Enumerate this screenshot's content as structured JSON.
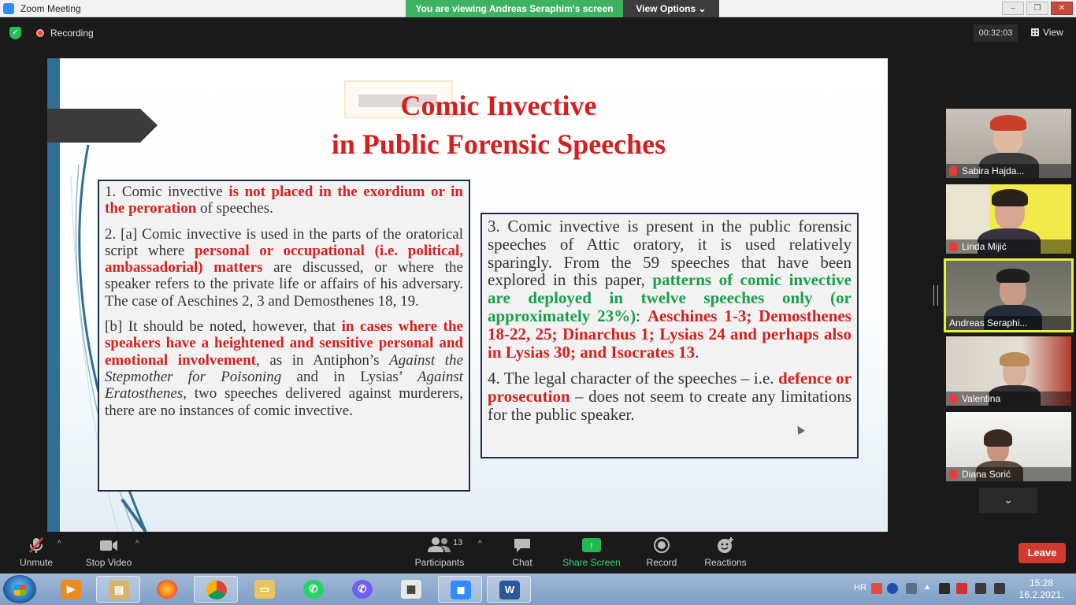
{
  "window": {
    "title": "Zoom Meeting"
  },
  "banner": {
    "viewing_text": "You are viewing Andreas Seraphim's screen",
    "view_options": "View Options"
  },
  "meeting": {
    "recording_label": "Recording",
    "timer": "00:32:03",
    "view_label": "View"
  },
  "slide": {
    "title_line1": "Comic Invective",
    "title_line2": "in Public Forensic Speeches",
    "box1": {
      "p1_a": "1. Comic invective ",
      "p1_b": "is not placed in the exordium or in the peroration",
      "p1_c": " of speeches.",
      "p2_a": "2. [a] Comic invective is used in the parts of the oratorical script where ",
      "p2_b": "personal or occupational (i.e. political, ambassadorial) matters",
      "p2_c": " are discussed, or where the speaker refers to the private life or affairs of his adversary. The case of Aeschines 2, 3 and Demosthenes 18, 19.",
      "p3_a": "[b] It should be noted, however, that ",
      "p3_b": "in cases where the speakers have a heightened and sensitive personal and emotional involvement",
      "p3_c": ", as in Antiphon’s ",
      "p3_d": "Against the Stepmother for Poisoning",
      "p3_e": " and in Lysias’ ",
      "p3_f": "Against Eratosthenes",
      "p3_g": ", two speeches delivered against murderers, there are no instances of comic invective."
    },
    "box2": {
      "p1_a": "3. Comic invective is present in the public forensic speeches of Attic oratory, it is used relatively sparingly. From the 59 speeches that have been explored in this paper, ",
      "p1_b": "patterns of comic invective are deployed in twelve speeches only (or approximately 23%)",
      "p1_c": ": ",
      "p1_d": "Aeschines 1-3; Demosthenes 18-22, 25; Dinarchus 1; Lysias 24 and perhaps also in Lysias 30; and Isocrates 13",
      "p1_e": ".",
      "p2_a": "4. The legal character of the speeches – i.e. ",
      "p2_b": "defence or prosecution",
      "p2_c": " – does not seem to create any limitations for the public speaker."
    }
  },
  "participants": [
    {
      "name": "Sabira Hajda...",
      "muted": true
    },
    {
      "name": "Linda Mijić",
      "muted": true
    },
    {
      "name": "Andreas Seraphi...",
      "muted": false,
      "active": true
    },
    {
      "name": "Valentina",
      "muted": true
    },
    {
      "name": "Diana Sorić",
      "muted": true
    }
  ],
  "toolbar": {
    "unmute": "Unmute",
    "stop_video": "Stop Video",
    "participants": "Participants",
    "participants_count": "13",
    "chat": "Chat",
    "share_screen": "Share Screen",
    "record": "Record",
    "reactions": "Reactions",
    "leave": "Leave"
  },
  "taskbar": {
    "apps": [
      "start-orb",
      "media-player",
      "file-explorer-window",
      "firefox",
      "chrome",
      "file-explorer",
      "whatsapp",
      "viber",
      "calculator",
      "zoom",
      "word"
    ],
    "language": "HR",
    "time": "15:28",
    "date": "16.2.2021."
  },
  "colors": {
    "accent_red": "#d61f1f",
    "accent_green": "#17a04b",
    "banner_green": "#3db361",
    "leave_red": "#d33a2f",
    "active_border": "#e8f23a"
  }
}
